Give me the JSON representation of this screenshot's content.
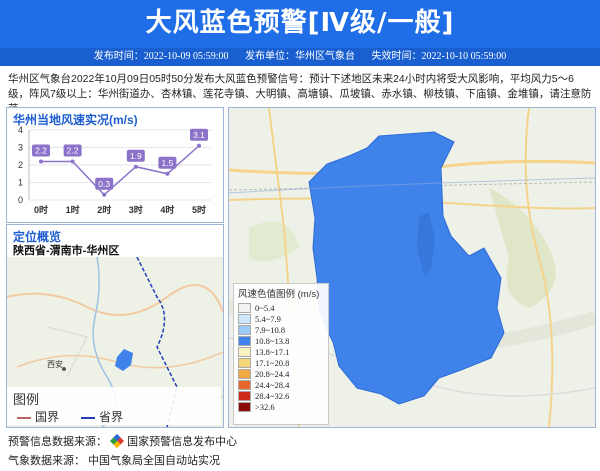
{
  "header": {
    "title": "大风蓝色预警[Ⅳ级/一般]",
    "issue_time_label": "发布时间：",
    "issue_time": "2022-10-09 05:59:00",
    "issuer_label": "发布单位：",
    "issuer": "华州区气象台",
    "expire_label": "失效时间：",
    "expire_time": "2022-10-10 05:59:00"
  },
  "description": "华州区气象台2022年10月09日05时50分发布大风蓝色预警信号：预计下述地区未来24小时内将受大风影响，平均风力5～6级，阵风7级以上：华州街道办、杏林镇、莲花寺镇、大明镇、高塘镇、瓜坡镇、赤水镇、柳枝镇、下庙镇、金堆镇，请注意防范。",
  "wind_panel": {
    "title": "华州当地风速实况(m/s)",
    "chart_data": {
      "type": "line",
      "categories": [
        "0时",
        "1时",
        "2时",
        "3时",
        "4时",
        "5时"
      ],
      "values": [
        2.2,
        2.2,
        0.3,
        1.9,
        1.5,
        3.1
      ],
      "ylim": [
        0,
        4
      ],
      "yticks": [
        "0",
        "1",
        "2",
        "3",
        "4"
      ],
      "color": "#8a73c9"
    }
  },
  "location_panel": {
    "title": "定位概览",
    "region": "陕西省-渭南市-华州区",
    "map_labels": {
      "city": "西安"
    },
    "legend_title": "图例",
    "legend_items": [
      {
        "label": "国界",
        "color": "#c0636b"
      },
      {
        "label": "省界",
        "color": "#2340b8"
      }
    ]
  },
  "map_legend": {
    "title": "风速色值图例 (m/s)",
    "items": [
      {
        "label": "0~5.4",
        "color": "#f2f2f2"
      },
      {
        "label": "5.4~7.9",
        "color": "#cfe6fb"
      },
      {
        "label": "7.9~10.8",
        "color": "#9dcaf5"
      },
      {
        "label": "10.8~13.8",
        "color": "#3f83ea"
      },
      {
        "label": "13.8~17.1",
        "color": "#f9f3c2"
      },
      {
        "label": "17.1~20.8",
        "color": "#f5d67a"
      },
      {
        "label": "20.8~24.4",
        "color": "#f0a840"
      },
      {
        "label": "24.4~28.4",
        "color": "#e8682b"
      },
      {
        "label": "28.4~32.6",
        "color": "#cf2a1c"
      },
      {
        "label": ">32.6",
        "color": "#8c0c0c"
      }
    ],
    "region_color": "#3f83ea"
  },
  "footer": {
    "warning_source_label": "预警信息数据来源：",
    "warning_source": "国家预警信息发布中心",
    "weather_source_label": "气象数据来源：",
    "weather_source": "中国气象局全国自动站实况"
  }
}
